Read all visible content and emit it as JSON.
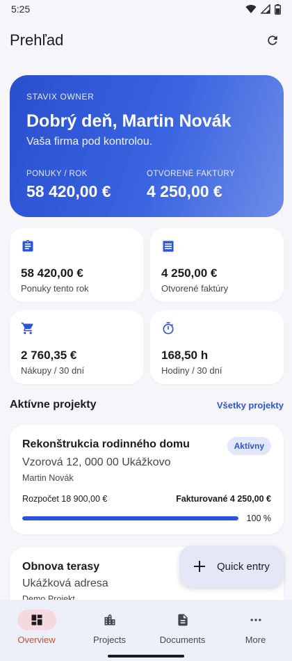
{
  "status_bar": {
    "time": "5:25"
  },
  "header": {
    "title": "Prehľad"
  },
  "hero": {
    "eyebrow": "STAVIX OWNER",
    "greeting": "Dobrý deň, Martin Novák",
    "subtitle": "Vaša firma pod kontrolou.",
    "metrics": [
      {
        "label": "PONUKY / ROK",
        "value": "58 420,00 €"
      },
      {
        "label": "OTVORENÉ FAKTÚRY",
        "value": "4 250,00 €"
      }
    ]
  },
  "stats": [
    {
      "icon": "clipboard-icon",
      "value": "58 420,00 €",
      "label": "Ponuky tento rok"
    },
    {
      "icon": "receipt-icon",
      "value": "4 250,00 €",
      "label": "Otvorené faktúry"
    },
    {
      "icon": "cart-icon",
      "value": "2 760,35 €",
      "label": "Nákupy / 30 dní"
    },
    {
      "icon": "timer-icon",
      "value": "168,50 h",
      "label": "Hodiny / 30 dní"
    }
  ],
  "projects_section": {
    "title": "Aktívne projekty",
    "link": "Všetky projekty"
  },
  "projects": [
    {
      "title": "Rekonštrukcia rodinného domu",
      "status": "Aktívny",
      "address": "Vzorová 12, 000 00 Ukážkovo",
      "owner": "Martin Novák",
      "budget": "Rozpočet 18 900,00 €",
      "invoiced": "Fakturované 4 250,00 €",
      "progress": 100,
      "progress_label": "100 %"
    },
    {
      "title": "Obnova terasy",
      "address": "Ukážková adresa",
      "owner": "Demo Projekt"
    }
  ],
  "fab": {
    "label": "Quick entry"
  },
  "nav": [
    {
      "label": "Overview",
      "icon": "dashboard-icon",
      "active": true
    },
    {
      "label": "Projects",
      "icon": "building-icon",
      "active": false
    },
    {
      "label": "Documents",
      "icon": "document-icon",
      "active": false
    },
    {
      "label": "More",
      "icon": "more-icon",
      "active": false
    }
  ],
  "colors": {
    "accent": "#2a55d8",
    "active_nav": "#d24b2a"
  }
}
